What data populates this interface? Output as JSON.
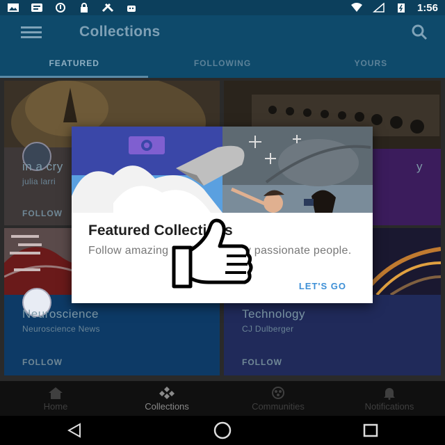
{
  "status_bar": {
    "time": "1:56",
    "icons": [
      "image-icon",
      "message-icon",
      "circle-info-icon",
      "lock-icon",
      "tools-icon",
      "android-icon"
    ],
    "right_icons": [
      "wifi-icon",
      "signal-off-icon",
      "battery-charging-icon"
    ]
  },
  "app_bar": {
    "title": "Collections",
    "icons": [
      "menu-icon",
      "search-icon"
    ]
  },
  "tabs": [
    {
      "label": "FEATURED",
      "active": true
    },
    {
      "label": "FOLLOWING",
      "active": false
    },
    {
      "label": "YOURS",
      "active": false
    }
  ],
  "cards": [
    {
      "title": "in a cry",
      "author": "julia larri",
      "follow_label": "FOLLOW"
    },
    {
      "title": "y",
      "author": "",
      "follow_label": ""
    },
    {
      "title": "Neuroscience",
      "author": "Neuroscience News",
      "follow_label": "FOLLOW"
    },
    {
      "title": "Technology",
      "author": "CJ Dulberger",
      "follow_label": "FOLLOW"
    }
  ],
  "bottom_nav": [
    {
      "label": "Home",
      "icon": "home-icon",
      "active": false
    },
    {
      "label": "Collections",
      "icon": "collections-icon",
      "active": true
    },
    {
      "label": "Communities",
      "icon": "communities-icon",
      "active": false
    },
    {
      "label": "Notifications",
      "icon": "bell-icon",
      "active": false
    }
  ],
  "system_nav": [
    "back-icon",
    "home-circle-icon",
    "recents-icon"
  ],
  "dialog": {
    "title": "Featured Collections",
    "text": "Follow amazing stuff created by passionate people.",
    "button": "LET'S GO"
  },
  "colors": {
    "app_bar": "#0e4a6b",
    "accent": "#3d8fd6",
    "dialog_art_blue": "#3a47a8"
  }
}
